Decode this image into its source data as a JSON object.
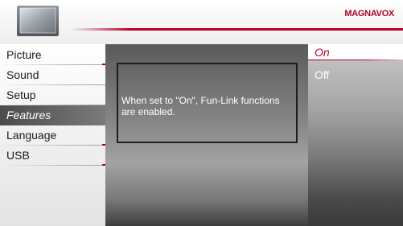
{
  "header": {
    "brand": "MAGNAVOX",
    "tv_icon": "tv-screen-icon",
    "accent_color": "#b30026"
  },
  "menu": {
    "items": [
      {
        "label": "Picture"
      },
      {
        "label": "Sound"
      },
      {
        "label": "Setup"
      },
      {
        "label": "Features"
      },
      {
        "label": "Language"
      },
      {
        "label": "USB"
      }
    ],
    "selected": "Features"
  },
  "info": {
    "text": "When set to \"On\", Fun-Link functions are enabled."
  },
  "options": {
    "items": [
      {
        "label": "On"
      },
      {
        "label": "Off"
      }
    ],
    "selected": "On"
  }
}
